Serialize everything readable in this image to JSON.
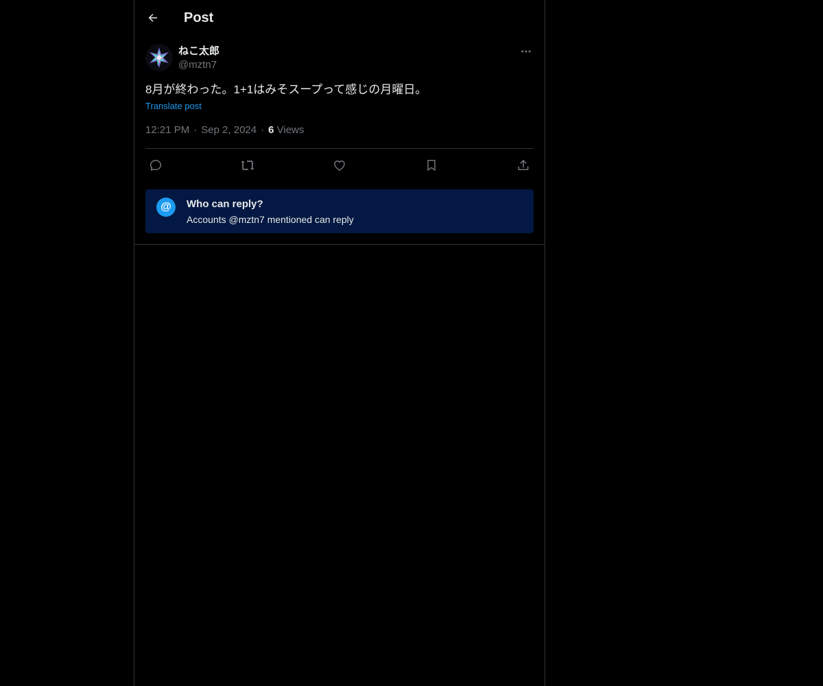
{
  "header": {
    "back_icon": "arrow-left-icon",
    "title": "Post"
  },
  "post": {
    "author": {
      "display_name": "ねこ太郎",
      "handle": "@mztn7",
      "avatar_icon": "avatar"
    },
    "more_icon": "more-horizontal-icon",
    "text": "8月が終わった。1+1はみそスープって感じの月曜日。",
    "translate_label": "Translate post",
    "time": "12:21 PM",
    "date": "Sep 2, 2024",
    "views_count": "6",
    "views_label": "Views",
    "actions": [
      {
        "name": "reply",
        "icon": "reply-icon"
      },
      {
        "name": "repost",
        "icon": "repost-icon"
      },
      {
        "name": "like",
        "icon": "like-icon"
      },
      {
        "name": "bookmark",
        "icon": "bookmark-icon"
      },
      {
        "name": "share",
        "icon": "share-icon"
      }
    ]
  },
  "reply_restriction": {
    "icon": "@",
    "title": "Who can reply?",
    "subtitle": "Accounts @mztn7 mentioned can reply"
  },
  "colors": {
    "background": "#000000",
    "text_primary": "#e7e9ea",
    "text_secondary": "#71767b",
    "link": "#1d9bf0",
    "border": "#2f3336",
    "reply_box_bg": "#031842"
  }
}
